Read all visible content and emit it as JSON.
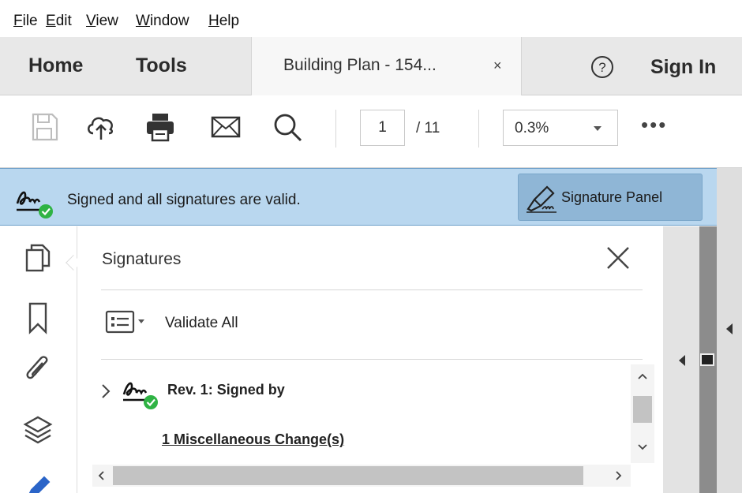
{
  "menu": {
    "items": [
      {
        "accel": "F",
        "rest": "ile"
      },
      {
        "accel": "E",
        "rest": "dit"
      },
      {
        "accel": "V",
        "rest": "iew"
      },
      {
        "accel": "W",
        "rest": "indow"
      },
      {
        "accel": "H",
        "rest": "elp"
      }
    ]
  },
  "tabs": {
    "home": "Home",
    "tools": "Tools",
    "document_title": "Building Plan - 154...",
    "close_glyph": "×",
    "help_glyph": "?",
    "sign_in": "Sign In"
  },
  "toolbar": {
    "icons": [
      "save-icon",
      "upload-cloud-icon",
      "print-icon",
      "email-icon",
      "search-icon"
    ],
    "page_current": "1",
    "page_total": "/ 11",
    "zoom": "0.3%",
    "more": "•••"
  },
  "signature_bar": {
    "message": "Signed and all signatures are valid.",
    "button_label": "Signature Panel",
    "colors": {
      "bar": "#b9d7ef",
      "button": "#8fb6d6",
      "valid_green": "#2fb344"
    }
  },
  "left_rail": {
    "icons": [
      "pages-icon",
      "bookmark-icon",
      "attachment-icon",
      "layers-icon",
      "signature-tool-icon"
    ]
  },
  "signatures_panel": {
    "title": "Signatures",
    "validate_all": "Validate All",
    "revision": {
      "label": "Rev. 1: Signed by",
      "change": "1 Miscellaneous Change(s)"
    }
  }
}
